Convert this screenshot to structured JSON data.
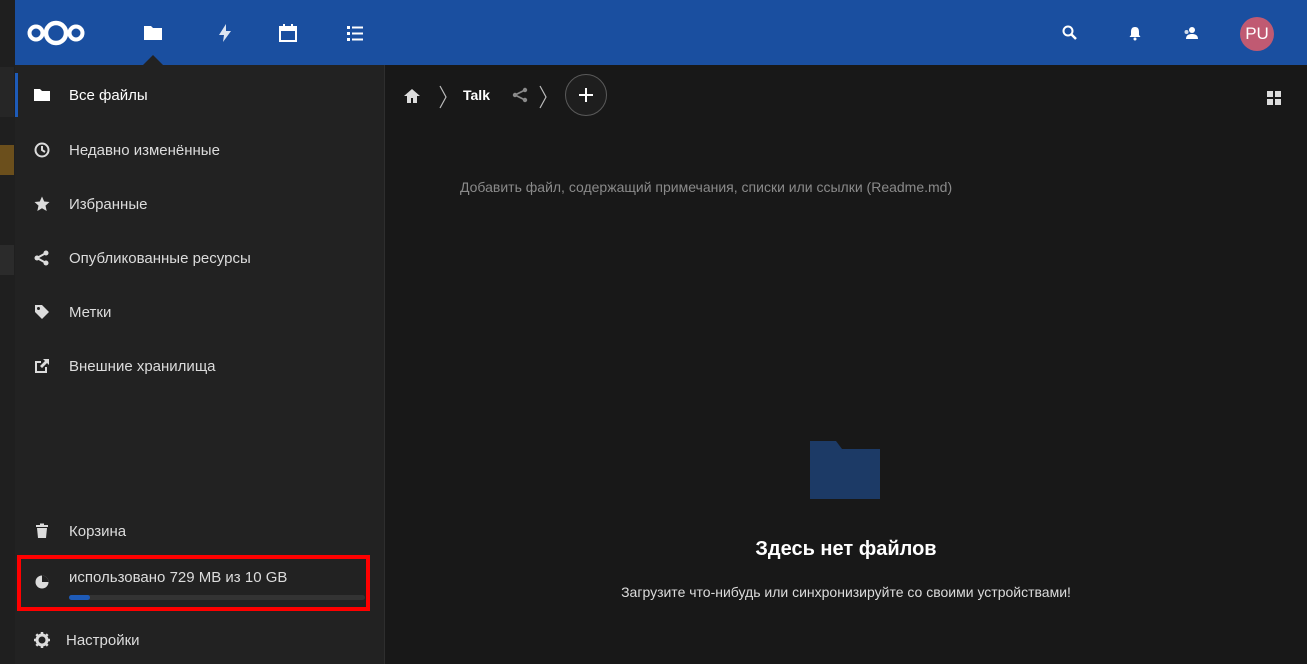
{
  "header": {
    "apps": [
      {
        "name": "files",
        "icon": "folder-icon"
      },
      {
        "name": "activity",
        "icon": "lightning-icon"
      },
      {
        "name": "calendar",
        "icon": "calendar-icon"
      },
      {
        "name": "tasks",
        "icon": "list-icon"
      }
    ],
    "right_icons": [
      "search-icon",
      "bell-icon",
      "contacts-icon"
    ],
    "avatar_initials": "PU",
    "colors": {
      "bar": "#1a4fa0",
      "avatar": "#c05a72"
    }
  },
  "sidebar": {
    "items": [
      {
        "label": "Все файлы",
        "icon": "folder-icon",
        "active": true
      },
      {
        "label": "Недавно изменённые",
        "icon": "clock-icon"
      },
      {
        "label": "Избранные",
        "icon": "star-icon"
      },
      {
        "label": "Опубликованные ресурсы",
        "icon": "share-icon"
      },
      {
        "label": "Метки",
        "icon": "tag-icon"
      },
      {
        "label": "Внешние хранилища",
        "icon": "external-link-icon"
      }
    ],
    "trash": {
      "label": "Корзина",
      "icon": "trash-icon"
    },
    "quota": {
      "label": "использовано 729 MB из 10 GB",
      "used_fraction": 0.07
    },
    "settings": {
      "label": "Настройки",
      "icon": "gear-icon"
    }
  },
  "main": {
    "breadcrumb": {
      "current": "Talk"
    },
    "readme_hint": "Добавить файл, содержащий примечания, списки или ссылки (Readme.md)",
    "empty": {
      "title": "Здесь нет файлов",
      "subtitle": "Загрузите что-нибудь или синхронизируйте со своими устройствами!"
    }
  }
}
